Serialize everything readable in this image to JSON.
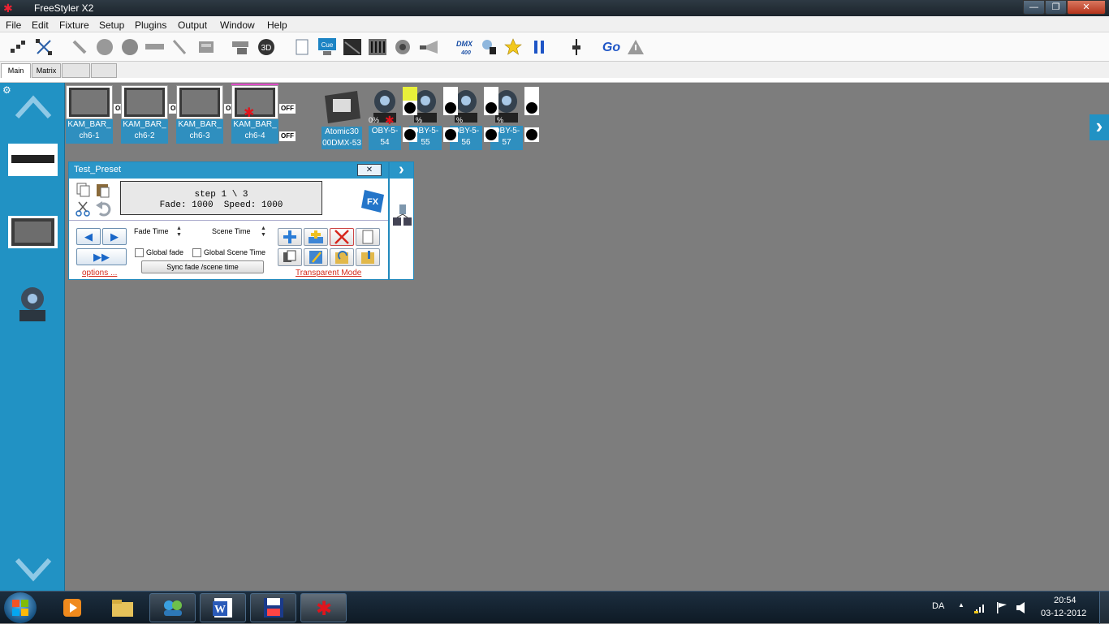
{
  "window": {
    "title": "FreeStyler X2",
    "minimize": "—",
    "maximize": "❐",
    "close": "✕"
  },
  "menu": [
    "File",
    "Edit",
    "Fixture",
    "Setup",
    "Plugins",
    "Output",
    "Window",
    "Help"
  ],
  "toolbar": {
    "icons": [
      "group-icon",
      "ungroup-icon",
      "wrench-icon",
      "circle-icon",
      "circle-gray-icon",
      "truss-icon",
      "pen-icon",
      "monitor-icon",
      "stack-icon",
      "3d-icon",
      "blank-page-icon",
      "cue-icon",
      "console-icon",
      "faders-icon",
      "speaker-icon",
      "horn-icon",
      "dmx-icon",
      "pointer-icon",
      "star-icon",
      "pause-icon",
      "fader-icon",
      "go-icon",
      "warning-icon"
    ],
    "cue_label": "Cue",
    "dmx_label": "DMX",
    "dmx_sub": "400",
    "three_d_label": "3D",
    "go_label": "Go"
  },
  "tabs": [
    "Main",
    "Matrix",
    "",
    ""
  ],
  "fixtures": [
    {
      "name1": "KAM_BAR_",
      "name2": "ch6-1",
      "off": "OFF",
      "sel": false
    },
    {
      "name1": "KAM_BAR_",
      "name2": "ch6-2",
      "off": "OFF",
      "sel": false
    },
    {
      "name1": "KAM_BAR_",
      "name2": "ch6-3",
      "off": "OFF",
      "sel": false
    },
    {
      "name1": "KAM_BAR_",
      "name2": "ch6-4",
      "off": "OFF",
      "sel": true
    }
  ],
  "strobe": {
    "name1": "Atomic30",
    "name2": "00DMX-53"
  },
  "movers": [
    {
      "name1": "OBY-5-",
      "name2": "54",
      "pct": "0%"
    },
    {
      "name1": "OBY-5-",
      "name2": "55",
      "pct": "%"
    },
    {
      "name1": "OBY-5-",
      "name2": "56",
      "pct": "%"
    },
    {
      "name1": "OBY-5-",
      "name2": "57",
      "pct": "%"
    }
  ],
  "preset": {
    "title": "Test_Preset",
    "close": "✕",
    "fx_label": "FX",
    "display_line1": "step 1 \\ 3",
    "display_line2": "Fade: 1000  Speed: 1000",
    "fade_time_label": "Fade Time",
    "scene_time_label": "Scene Time",
    "global_fade_label": "Global fade",
    "global_scene_time_label": "Global Scene Time",
    "sync_button": "Sync fade /scene time",
    "options_link": "options ...",
    "transparent_link": "Transparent Mode"
  },
  "side_panel": {
    "expand": "›"
  },
  "right_arrow": "›",
  "taskbar": {
    "lang": "DA",
    "time": "20:54",
    "date": "03-12-2012",
    "apps": [
      "media-player-icon",
      "explorer-icon",
      "messenger-icon",
      "word-icon",
      "floppy-icon",
      "freestyler-icon"
    ],
    "word_label": "W"
  },
  "colors": {
    "accent": "#2192c4",
    "canvas": "#7d7d7d",
    "link": "#d42a1a",
    "swatch_yellow": "#e8f03a",
    "stage_highlight": "#e04cc8"
  }
}
